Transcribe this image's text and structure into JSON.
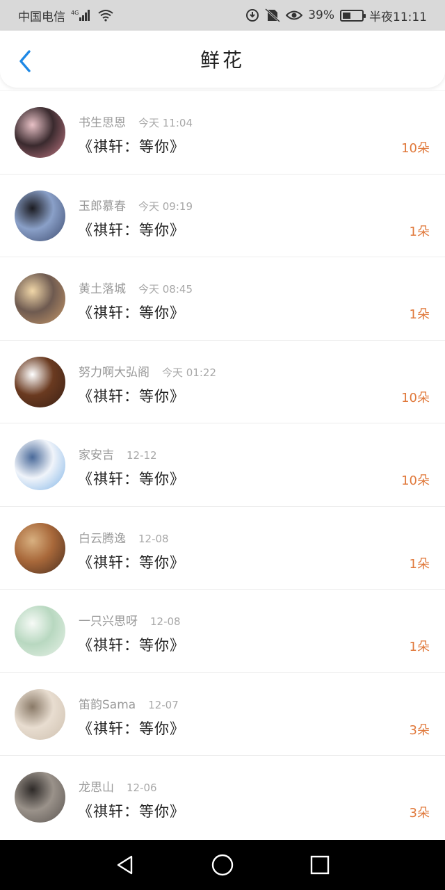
{
  "status_bar": {
    "carrier": "中国电信",
    "network": "4G",
    "battery_percent": "39%",
    "time": "半夜11:11",
    "icons": [
      "signal-icon",
      "wifi-icon",
      "data-saver-icon",
      "no-sim-icon",
      "eye-comfort-icon",
      "battery-icon"
    ]
  },
  "header": {
    "title": "鲜花",
    "back_icon": "chevron-left-icon"
  },
  "colors": {
    "accent_blue": "#1e88e5",
    "count_orange": "#e0783a"
  },
  "items": [
    {
      "name": "书生思恩",
      "time": "今天 11:04",
      "message": "《祺轩：等你》",
      "count": "10朵",
      "avatar_colors": [
        "#c47a86",
        "#3a2a2e",
        "#e8c1c6"
      ]
    },
    {
      "name": "玉郎慕春",
      "time": "今天 09:19",
      "message": "《祺轩：等你》",
      "count": "1朵",
      "avatar_colors": [
        "#3c4a6e",
        "#8aa0c8",
        "#1c1c22"
      ]
    },
    {
      "name": "黄土落城",
      "time": "今天 08:45",
      "message": "《祺轩：等你》",
      "count": "1朵",
      "avatar_colors": [
        "#c99a6a",
        "#6e5a50",
        "#f0d6a8"
      ]
    },
    {
      "name": "努力啊大弘阁",
      "time": "今天 01:22",
      "message": "《祺轩：等你》",
      "count": "10朵",
      "avatar_colors": [
        "#3a2015",
        "#6a3a20",
        "#ffffff"
      ]
    },
    {
      "name": "家安吉",
      "time": "12-12",
      "message": "《祺轩：等你》",
      "count": "10朵",
      "avatar_colors": [
        "#7fb3e6",
        "#f0f4fa",
        "#4a6a9a"
      ]
    },
    {
      "name": "白云腾逸",
      "time": "12-08",
      "message": "《祺轩：等你》",
      "count": "1朵",
      "avatar_colors": [
        "#4a2e1e",
        "#a8683a",
        "#d8b080"
      ]
    },
    {
      "name": "一只兴思呀",
      "time": "12-08",
      "message": "《祺轩：等你》",
      "count": "1朵",
      "avatar_colors": [
        "#e8f2e8",
        "#b8d8c0",
        "#f6faf6"
      ]
    },
    {
      "name": "笛韵Sama",
      "time": "12-07",
      "message": "《祺轩：等你》",
      "count": "3朵",
      "avatar_colors": [
        "#cdbfae",
        "#e8ddd0",
        "#8a7a68"
      ]
    },
    {
      "name": "龙思山",
      "time": "12-06",
      "message": "《祺轩：等你》",
      "count": "3朵",
      "avatar_colors": [
        "#5a5450",
        "#9a928a",
        "#2e2a28"
      ]
    }
  ],
  "nav": {
    "back": "nav-back-icon",
    "home": "nav-home-icon",
    "recents": "nav-recents-icon"
  }
}
